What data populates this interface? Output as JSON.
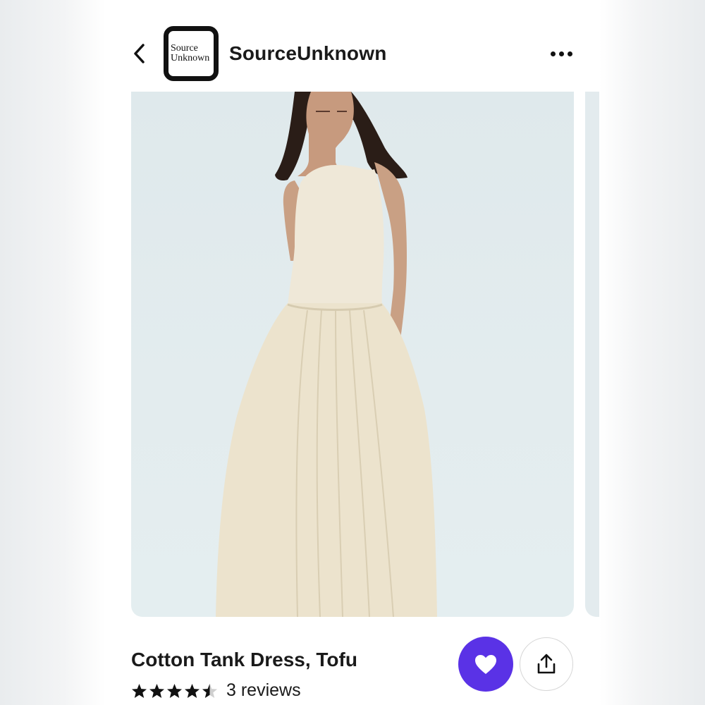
{
  "header": {
    "back_icon": "chevron-left-icon",
    "logo_line1": "Source",
    "logo_line2": "Unknown",
    "shop_name": "SourceUnknown",
    "more_icon": "ellipsis-horizontal-icon"
  },
  "product": {
    "title": "Cotton Tank Dress, Tofu",
    "rating": 4.5,
    "rating_max": 5,
    "reviews_label": "3 reviews"
  },
  "actions": {
    "favorite_icon": "heart-icon",
    "favorite_color": "#5a32e6",
    "share_icon": "share-upload-icon"
  }
}
